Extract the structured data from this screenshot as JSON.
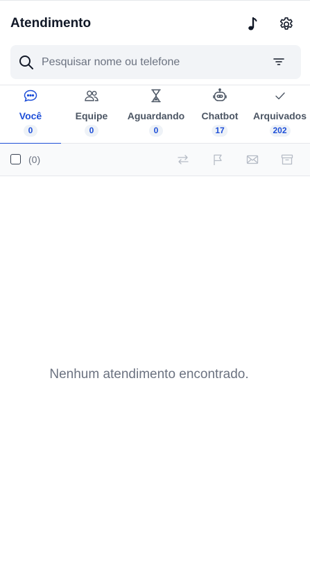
{
  "header": {
    "title": "Atendimento",
    "music_icon": "music-note-icon",
    "settings_icon": "gear-icon"
  },
  "search": {
    "placeholder": "Pesquisar nome ou telefone",
    "value": "",
    "search_icon": "search-icon",
    "filter_icon": "filter-icon"
  },
  "tabs": [
    {
      "label": "Você",
      "count": "0",
      "icon": "chat-bubble-icon",
      "active": true
    },
    {
      "label": "Equipe",
      "count": "0",
      "icon": "users-icon",
      "active": false
    },
    {
      "label": "Aguardando",
      "count": "0",
      "icon": "hourglass-icon",
      "active": false
    },
    {
      "label": "Chatbot",
      "count": "17",
      "icon": "robot-icon",
      "active": false
    },
    {
      "label": "Arquivados",
      "count": "202",
      "icon": "check-icon",
      "active": false
    }
  ],
  "actions": {
    "selected_count": "(0)",
    "icons": [
      "transfer-arrows-icon",
      "flag-icon",
      "envelope-icon",
      "archive-icon"
    ]
  },
  "empty_state": {
    "message": "Nenhum atendimento encontrado."
  },
  "colors": {
    "accent": "#1d4ed8",
    "muted_text": "#6b7280",
    "search_bg": "#f2f4f7"
  }
}
